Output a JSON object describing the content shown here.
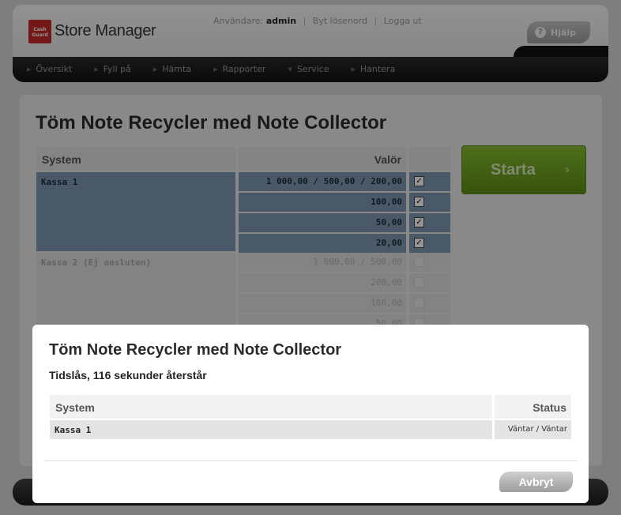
{
  "header": {
    "logo_text": [
      "Cash",
      "Guard"
    ],
    "app_title": "Store Manager",
    "user_label": "Användare:",
    "username": "admin",
    "separator": "|",
    "change_password": "Byt lösenord",
    "logout": "Logga ut",
    "help_label": "Hjälp",
    "help_icon_glyph": "?"
  },
  "nav": {
    "items": [
      {
        "label": "Översikt",
        "icon": "arrow-right-icon",
        "glyph": "▶"
      },
      {
        "label": "Fyll på",
        "icon": "arrow-right-icon",
        "glyph": "▶"
      },
      {
        "label": "Hämta",
        "icon": "arrow-right-icon",
        "glyph": "▶"
      },
      {
        "label": "Rapporter",
        "icon": "arrow-right-icon",
        "glyph": "▶"
      },
      {
        "label": "Service",
        "icon": "arrow-down-icon",
        "glyph": "▼"
      },
      {
        "label": "Hantera",
        "icon": "arrow-right-icon",
        "glyph": "▶"
      }
    ]
  },
  "main": {
    "title": "Töm Note Recycler med Note Collector",
    "table": {
      "header_system": "System",
      "header_valor": "Valör",
      "rows": [
        {
          "system": "Kassa 1",
          "value": "1 000,00 / 500,00 / 200,00",
          "checked": true,
          "active": true
        },
        {
          "system": "",
          "value": "100,00",
          "checked": true,
          "active": true
        },
        {
          "system": "",
          "value": "50,00",
          "checked": true,
          "active": true
        },
        {
          "system": "",
          "value": "20,00",
          "checked": true,
          "active": true
        },
        {
          "system": "Kassa 2 (Ej ansluten)",
          "value": "1 000,00 / 500,00",
          "checked": false,
          "active": false
        },
        {
          "system": "",
          "value": "200,00",
          "checked": false,
          "active": false
        },
        {
          "system": "",
          "value": "100,00",
          "checked": false,
          "active": false
        },
        {
          "system": "",
          "value": "50,00",
          "checked": false,
          "active": false
        }
      ]
    },
    "start_label": "Starta",
    "start_arrow": "›"
  },
  "modal": {
    "title": "Töm Note Recycler med Note Collector",
    "subtitle": "Tidslås, 116 sekunder återstår",
    "header_system": "System",
    "header_status": "Status",
    "row_system": "Kassa 1",
    "row_status": "Väntar / Väntar",
    "cancel_label": "Avbryt"
  },
  "colors": {
    "accent_green": "#6fa322",
    "selected_row": "#7f9ab3",
    "brand_red": "#c62828"
  }
}
